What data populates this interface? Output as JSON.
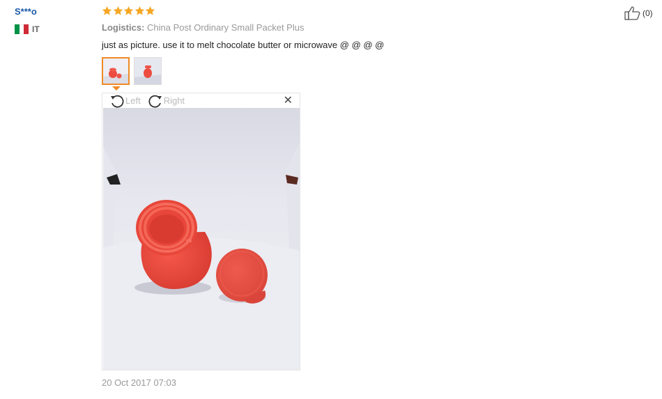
{
  "reviewer": {
    "name": "S***o",
    "country_code": "IT",
    "flag_colors": [
      "#009246",
      "#ffffff",
      "#ce2b37"
    ]
  },
  "rating": {
    "stars": 5,
    "max": 5,
    "color": "#f5a623"
  },
  "logistics": {
    "label": "Logistics:",
    "value": "China Post Ordinary Small Packet Plus"
  },
  "review_text": "just as picture. use it to melt chocolate butter or microwave @ @ @ @",
  "thumbnails": [
    {
      "name": "photo-1",
      "selected": true
    },
    {
      "name": "photo-2",
      "selected": false
    }
  ],
  "viewer": {
    "rotate_left_label": "Left",
    "rotate_right_label": "Right",
    "close_symbol": "✕"
  },
  "review_date": "20 Oct 2017 07:03",
  "helpful": {
    "count_label": "(0)"
  },
  "colors": {
    "accent": "#f08a24",
    "name_link": "#1a5aa8",
    "product_red": "#ec4b3f"
  }
}
